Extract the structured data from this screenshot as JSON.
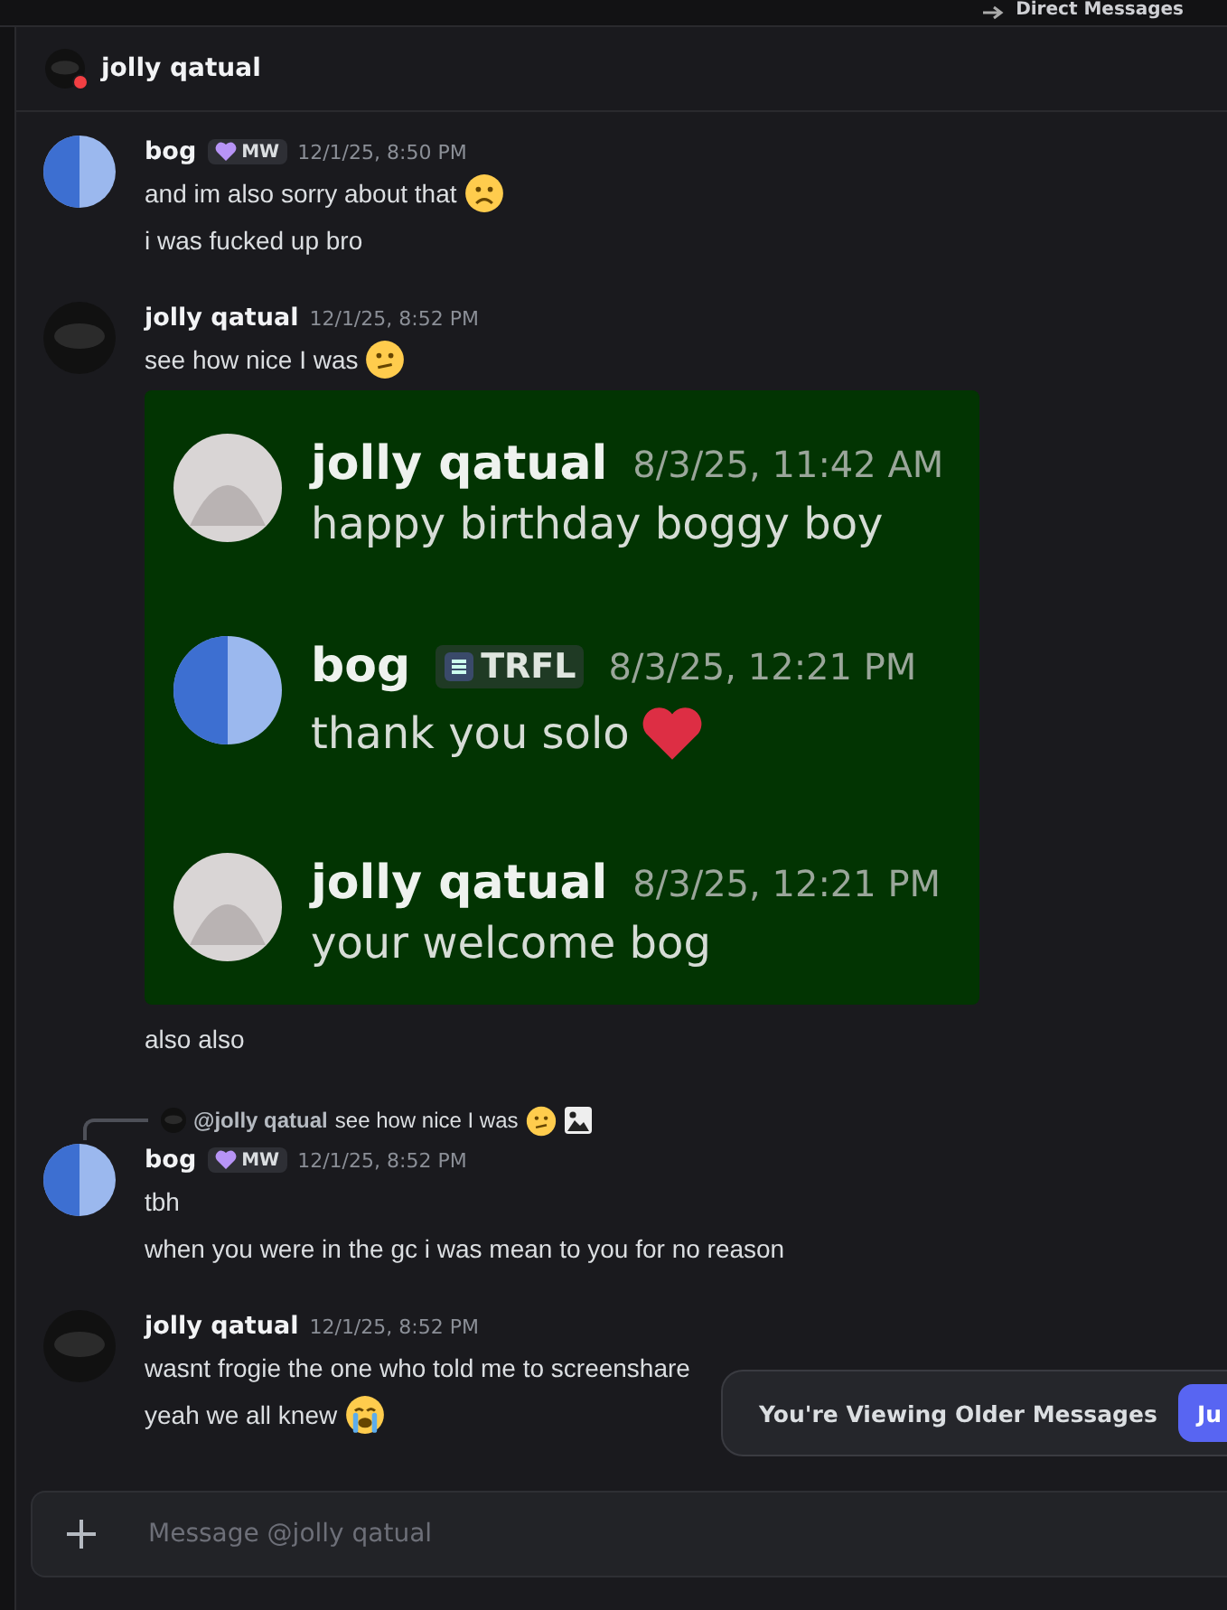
{
  "top_bar": {
    "title": "Direct Messages"
  },
  "header": {
    "name": "jolly qatual",
    "avatar": {
      "kind": "dark"
    },
    "status": {
      "kind": "dnd"
    }
  },
  "messages": [
    {
      "author": "bog",
      "avatar": {
        "kind": "finder"
      },
      "badge": "MW",
      "time": "12/1/25, 8:50 PM",
      "lines": [
        {
          "text": "and im also sorry about that",
          "emoji": {
            "kind": "frown"
          }
        },
        {
          "text": "i was fucked up bro"
        }
      ]
    },
    {
      "author": "jolly qatual",
      "avatar": {
        "kind": "dark"
      },
      "time": "12/1/25, 8:52 PM",
      "lines": [
        {
          "text": "see how nice I was",
          "emoji": {
            "kind": "slight"
          }
        }
      ],
      "screenshot": [
        {
          "author": "jolly qatual",
          "avatar": {
            "kind": "anime"
          },
          "time": "8/3/25, 11:42 AM",
          "text": "happy birthday boggy boy"
        },
        {
          "author": "bog",
          "avatar": {
            "kind": "finder"
          },
          "tag": "TRFL",
          "time": "8/3/25, 12:21 PM",
          "text": "thank you solo",
          "emoji": {
            "kind": "heart"
          }
        },
        {
          "author": "jolly qatual",
          "avatar": {
            "kind": "anime"
          },
          "time": "8/3/25, 12:21 PM",
          "text": "your welcome bog"
        }
      ],
      "after": [
        {
          "text": "also also"
        }
      ]
    },
    {
      "reply": {
        "author": "@jolly qatual",
        "avatar": {
          "kind": "dark"
        },
        "text": "see how nice I was",
        "emoji": {
          "kind": "slight"
        },
        "attachment": true
      },
      "author": "bog",
      "avatar": {
        "kind": "finder"
      },
      "badge": "MW",
      "time": "12/1/25, 8:52 PM",
      "lines": [
        {
          "text": "tbh"
        },
        {
          "text": "when you were in the gc i was mean to you for no reason"
        }
      ]
    },
    {
      "author": "jolly qatual",
      "avatar": {
        "kind": "dark"
      },
      "time": "12/1/25, 8:52 PM",
      "lines": [
        {
          "text": "wasnt frogie the one who told me to screenshare"
        },
        {
          "text": "yeah we all knew",
          "emoji": {
            "kind": "sob"
          }
        }
      ]
    }
  ],
  "older_notice": {
    "text": "You're Viewing Older Messages",
    "button": "Ju"
  },
  "composer": {
    "placeholder": "Message @jolly qatual"
  }
}
